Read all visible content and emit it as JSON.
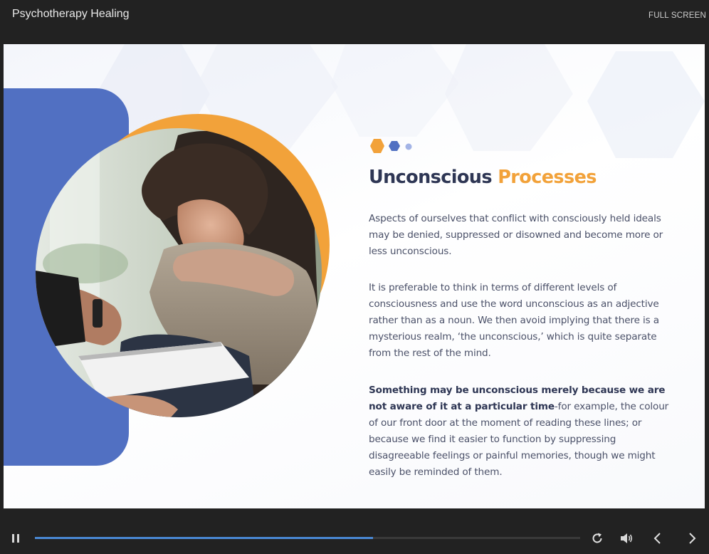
{
  "header": {
    "title": "Psychotherapy Healing",
    "fullscreen_label": "FULL SCREEN"
  },
  "slide": {
    "heading_main": "Unconscious",
    "heading_accent": "Processes",
    "paragraph_1": "Aspects of ourselves that conflict with consciously held ideals may be denied, suppressed or disowned and become more or less unconscious.",
    "paragraph_2": "It is preferable to think in terms of different levels of consciousness and use the word unconscious as an adjective rather than as a noun. We then avoid implying that there is a mysterious realm, ‘the unconscious,’ which is quite separate from the rest of the mind.",
    "paragraph_3_bold": "Something may be unconscious merely because we are not aware of it at a particular time",
    "paragraph_3_rest": "-for example, the colour of our front door at the moment of reading these lines; or because we find it easier to function by suppressing disagreeable feelings or painful memories, though we might easily be reminded of them."
  },
  "player": {
    "progress_fraction": 0.62,
    "icons": [
      "pause-icon",
      "replay-icon",
      "volume-icon",
      "chevron-left-icon",
      "chevron-right-icon"
    ]
  },
  "colors": {
    "background_dark": "#222222",
    "accent_orange": "#f2a23a",
    "accent_blue": "#5170c2",
    "heading_navy": "#2e3654",
    "progress_blue": "#4a88d4"
  }
}
